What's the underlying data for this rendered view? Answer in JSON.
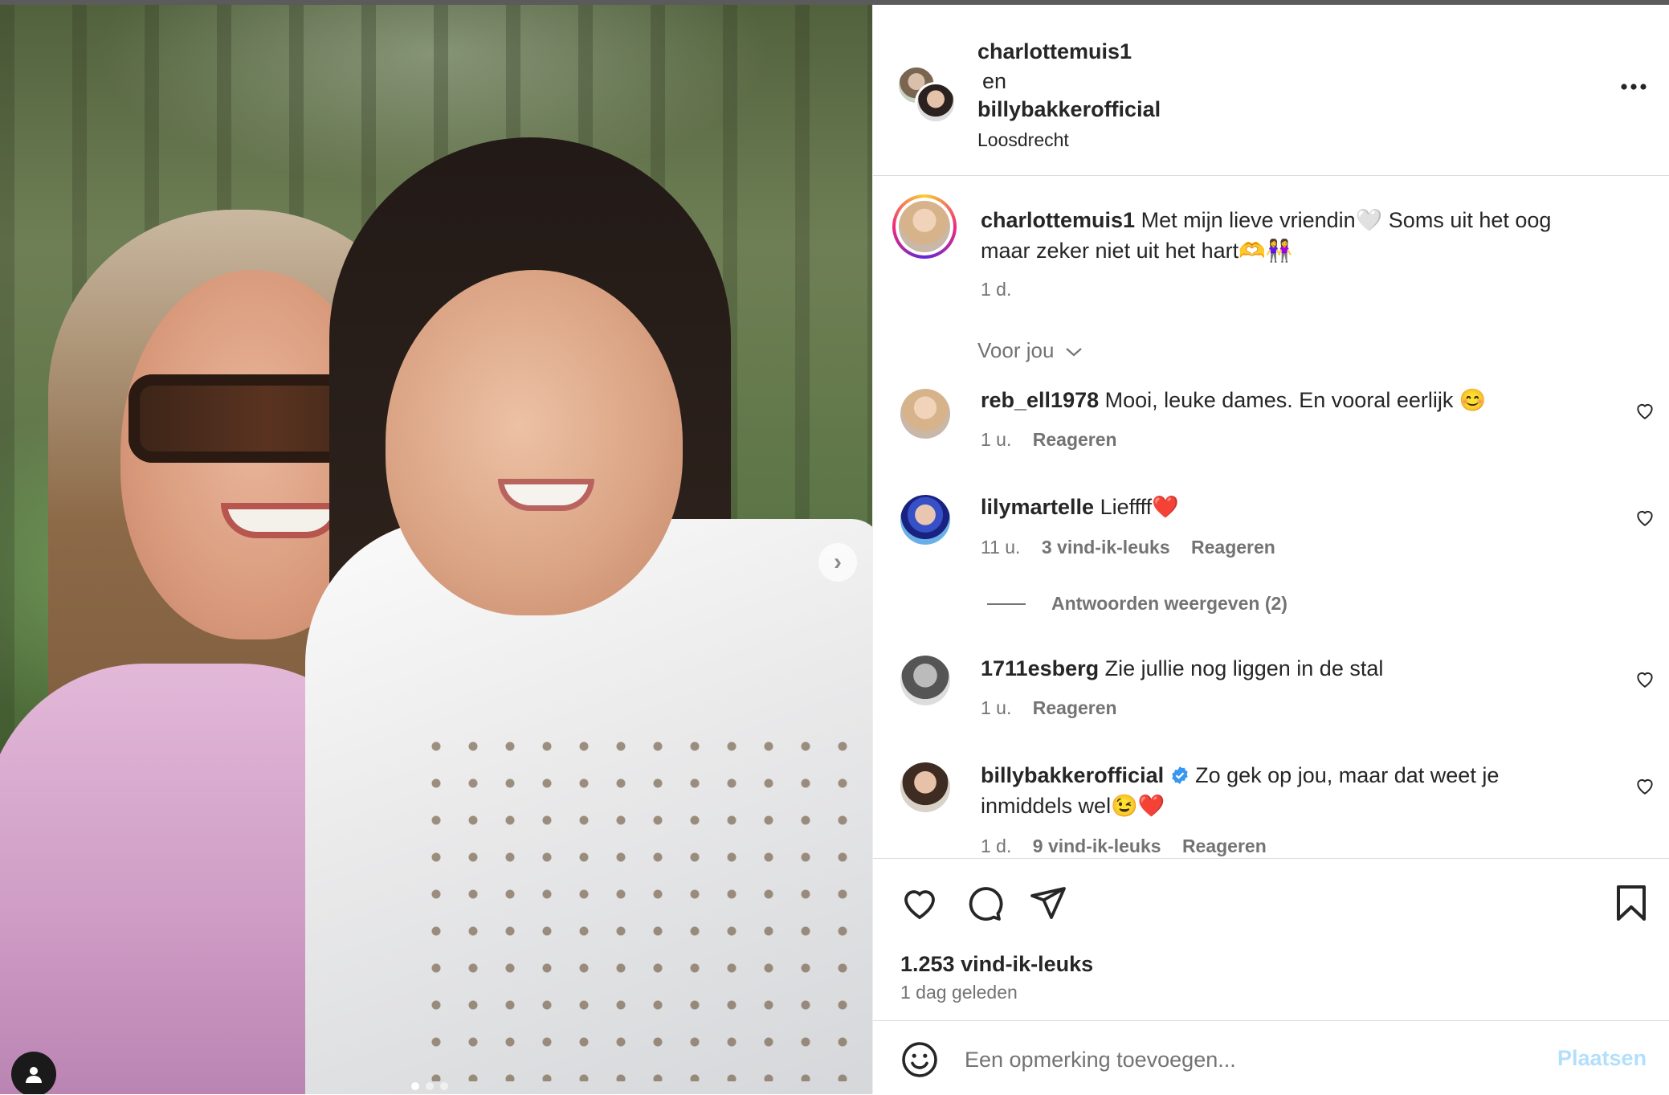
{
  "post": {
    "author": "charlottemuis1",
    "and_word": "en",
    "collaborator": "billybakkerofficial",
    "location": "Loosdrecht",
    "more_icon": "more-horizontal-icon",
    "caption_line1": "Met mijn lieve vriendin🤍 Soms uit het oog",
    "caption_line2": "maar zeker niet uit het hart🫶👭",
    "caption_time": "1 d.",
    "carousel_next_icon": "chevron-right-icon",
    "carousel_total": 3,
    "carousel_index": 1
  },
  "filter": {
    "label": "Voor jou",
    "icon": "chevron-down-icon"
  },
  "comments": [
    {
      "user": "reb_ell1978",
      "text": "Mooi, leuke dames. En vooral eerlijk 😊",
      "time": "1 u.",
      "likes": "",
      "reply": "Reageren"
    },
    {
      "user": "lilymartelle",
      "text": "Lieffff❤️",
      "time": "11 u.",
      "likes": "3 vind-ik-leuks",
      "reply": "Reageren",
      "replies_label": "Antwoorden weergeven (2)"
    },
    {
      "user": "1711esberg",
      "text": "Zie jullie nog liggen in de stal",
      "time": "1 u.",
      "likes": "",
      "reply": "Reageren"
    },
    {
      "user": "billybakkerofficial",
      "verified": true,
      "text": "Zo gek op jou, maar dat weet je",
      "text_line2": "inmiddels wel😉❤️",
      "time": "1 d.",
      "likes": "9 vind-ik-leuks",
      "reply": "Reageren"
    }
  ],
  "actions": {
    "like_icon": "heart-icon",
    "comment_icon": "comment-icon",
    "share_icon": "send-icon",
    "save_icon": "bookmark-icon",
    "likes_count": "1.253 vind-ik-leuks",
    "posted": "1 dag geleden"
  },
  "composer": {
    "emoji_icon": "smiley-icon",
    "placeholder": "Een opmerking toevoegen...",
    "submit_label": "Plaatsen"
  },
  "colors": {
    "accent": "#0095f6",
    "submit_disabled": "#b2dffc",
    "verified": "#3897f0",
    "heart_red": "#ed4956"
  }
}
